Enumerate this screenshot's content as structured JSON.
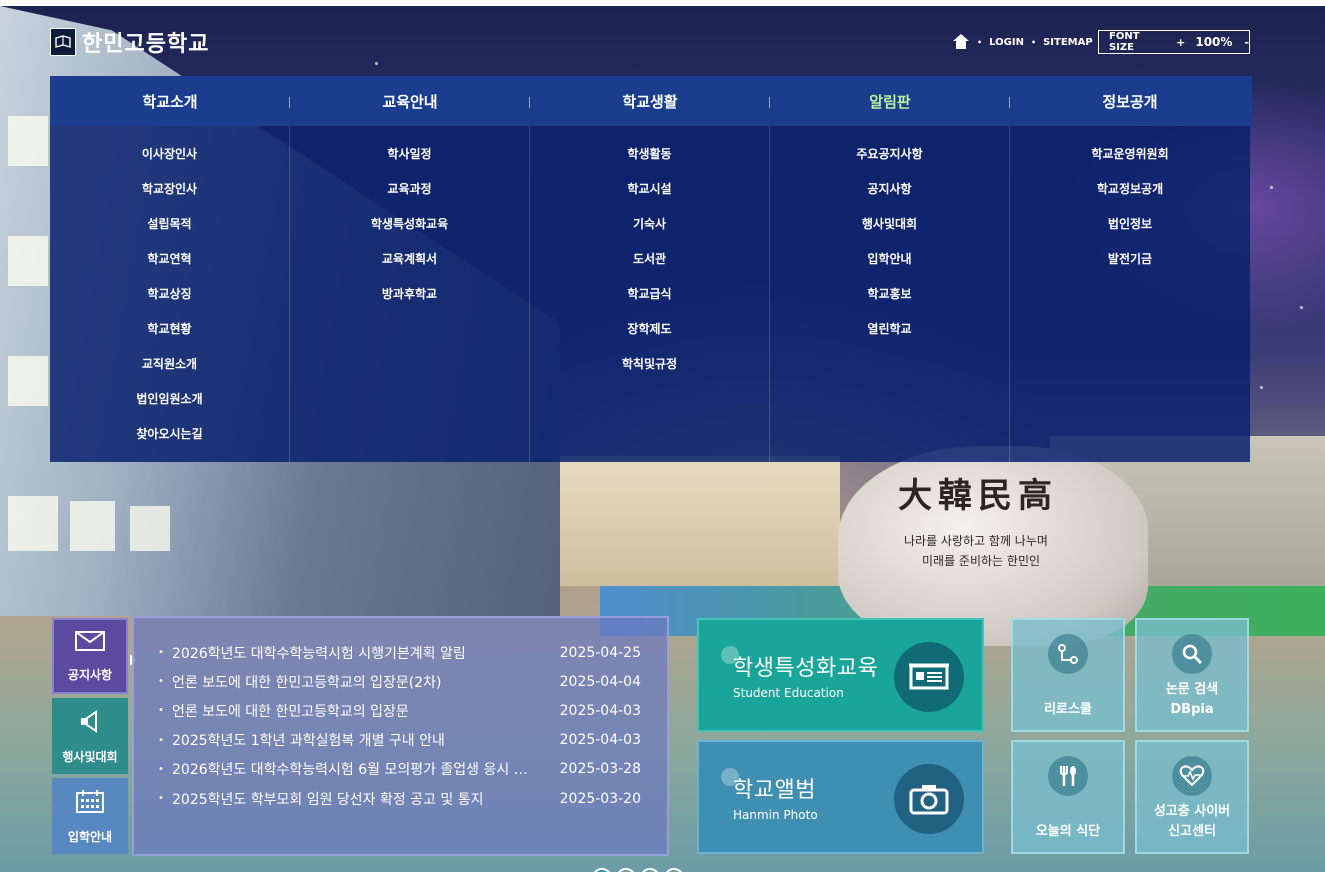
{
  "header": {
    "logo_text": "한민고등학교",
    "util_links": [
      "LOGIN",
      "SITEMAP"
    ],
    "font_size": {
      "label": "FONT SIZE",
      "plus": "+",
      "value": "100%",
      "minus": "-"
    }
  },
  "gnb": {
    "tabs": [
      {
        "label": "학교소개",
        "active": false
      },
      {
        "label": "교육안내",
        "active": false
      },
      {
        "label": "학교생활",
        "active": false
      },
      {
        "label": "알림판",
        "active": true
      },
      {
        "label": "정보공개",
        "active": false
      }
    ],
    "columns": [
      [
        "이사장인사",
        "학교장인사",
        "설립목적",
        "학교연혁",
        "학교상징",
        "학교현황",
        "교직원소개",
        "법인임원소개",
        "찾아오시는길"
      ],
      [
        "학사일정",
        "교육과정",
        "학생특성화교육",
        "교육계획서",
        "방과후학교"
      ],
      [
        "학생활동",
        "학교시설",
        "기숙사",
        "도서관",
        "학교급식",
        "장학제도",
        "학칙및규정"
      ],
      [
        "주요공지사항",
        "공지사항",
        "행사및대회",
        "입학안내",
        "학교홍보",
        "열린학교"
      ],
      [
        "학교운영위원회",
        "학교정보공개",
        "법인정보",
        "발전기금"
      ]
    ]
  },
  "hero": {
    "rock_title": "大韓民高",
    "rock_line1": "나라를 사랑하고 함께 나누며",
    "rock_line2": "미래를 준비하는 한민인"
  },
  "notice": {
    "tabs": [
      "공지사항",
      "행사및대회",
      "입학안내"
    ],
    "items": [
      {
        "title": "2026학년도 대학수학능력시험 시행기본계획 알림",
        "date": "2025-04-25"
      },
      {
        "title": "언론 보도에 대한 한민고등학교의 입장문(2차)",
        "date": "2025-04-04"
      },
      {
        "title": "언론 보도에 대한 한민고등학교의 입장문",
        "date": "2025-04-03"
      },
      {
        "title": "2025학년도 1학년 과학실험복 개별 구내 안내",
        "date": "2025-04-03"
      },
      {
        "title": "2026학년도 대학수학능력시험 6월 모의평가 졸업생 응시 …",
        "date": "2025-03-28"
      },
      {
        "title": "2025학년도 학부모회 임원 당선자 확정 공고 및 통지",
        "date": "2025-03-20"
      }
    ]
  },
  "features": {
    "edu": {
      "title": "학생특성화교육",
      "subtitle": "Student Education",
      "icon": "presentation-icon"
    },
    "photo": {
      "title": "학교앨범",
      "subtitle": "Hanmin Photo",
      "icon": "camera-icon"
    }
  },
  "quick": {
    "riro": "리로스쿨",
    "dbpia_1": "논문 검색",
    "dbpia_2": "DBpia",
    "meal": "오늘의 식단",
    "cyber_1": "성고충 사이버",
    "cyber_2": "신고센터"
  },
  "colors": {
    "gnb_bar": "#1a3d8e",
    "gnb_active": "#b9f0a0",
    "edu_tile": "#1aa59a",
    "photo_tile": "#3f8fb2"
  }
}
